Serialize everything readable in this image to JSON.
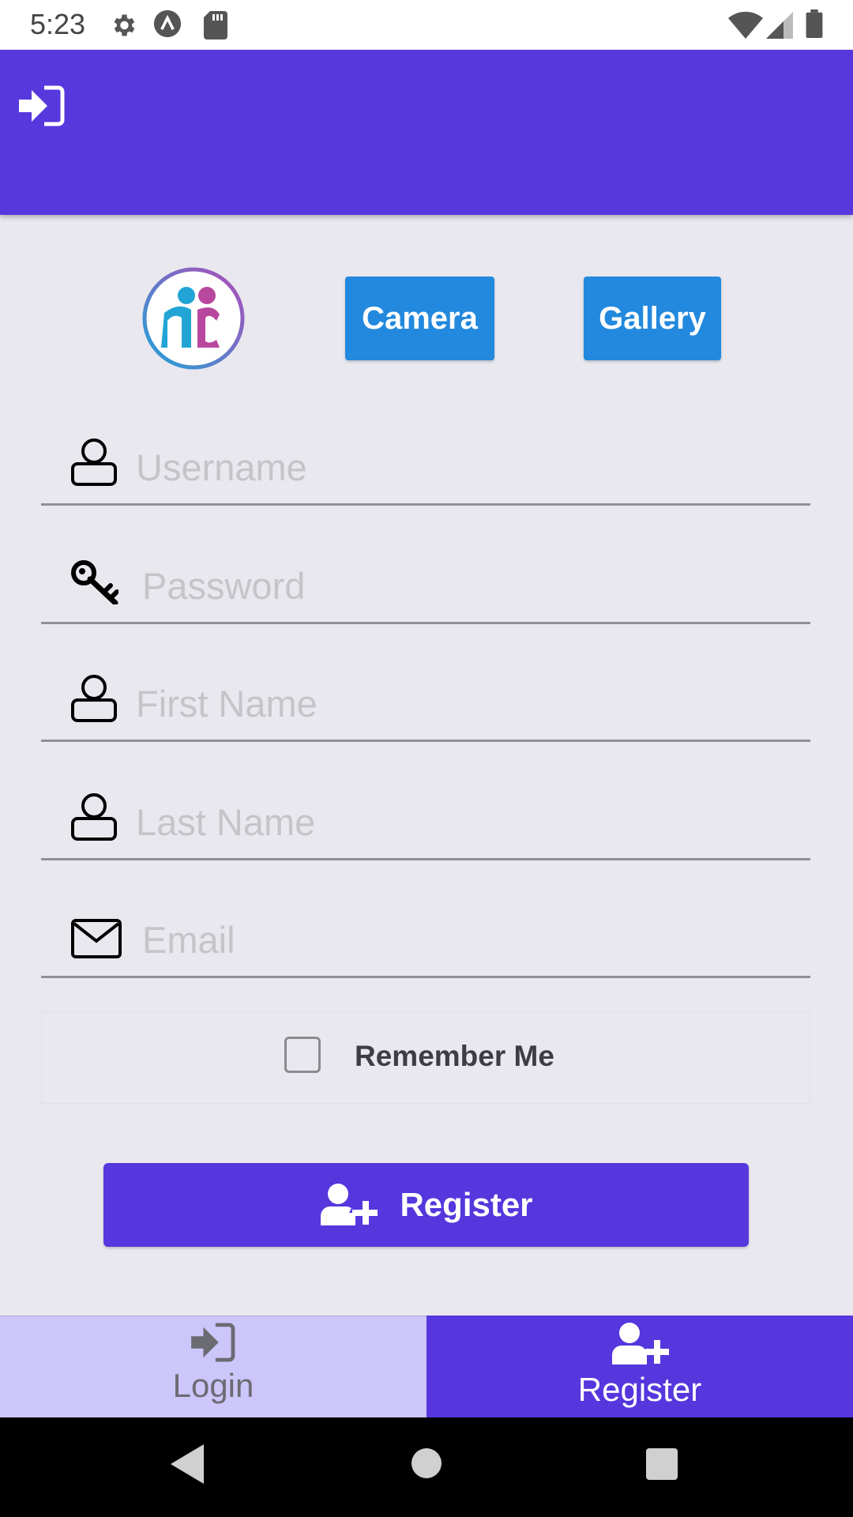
{
  "status_bar": {
    "time": "5:23"
  },
  "header": {
    "icon": "sign-in-icon"
  },
  "media": {
    "camera_label": "Camera",
    "gallery_label": "Gallery"
  },
  "form": {
    "username_placeholder": "Username",
    "password_placeholder": "Password",
    "first_name_placeholder": "First Name",
    "last_name_placeholder": "Last Name",
    "email_placeholder": "Email",
    "remember_label": "Remember Me",
    "remember_checked": false,
    "register_label": "Register"
  },
  "tabs": [
    {
      "label": "Login",
      "icon": "sign-in-icon",
      "active": false
    },
    {
      "label": "Register",
      "icon": "user-plus-icon",
      "active": true
    }
  ],
  "colors": {
    "primary": "#5738dd",
    "button_blue": "#2289de",
    "tab_inactive_bg": "#ccc6fa",
    "background": "#e9e8ef"
  }
}
